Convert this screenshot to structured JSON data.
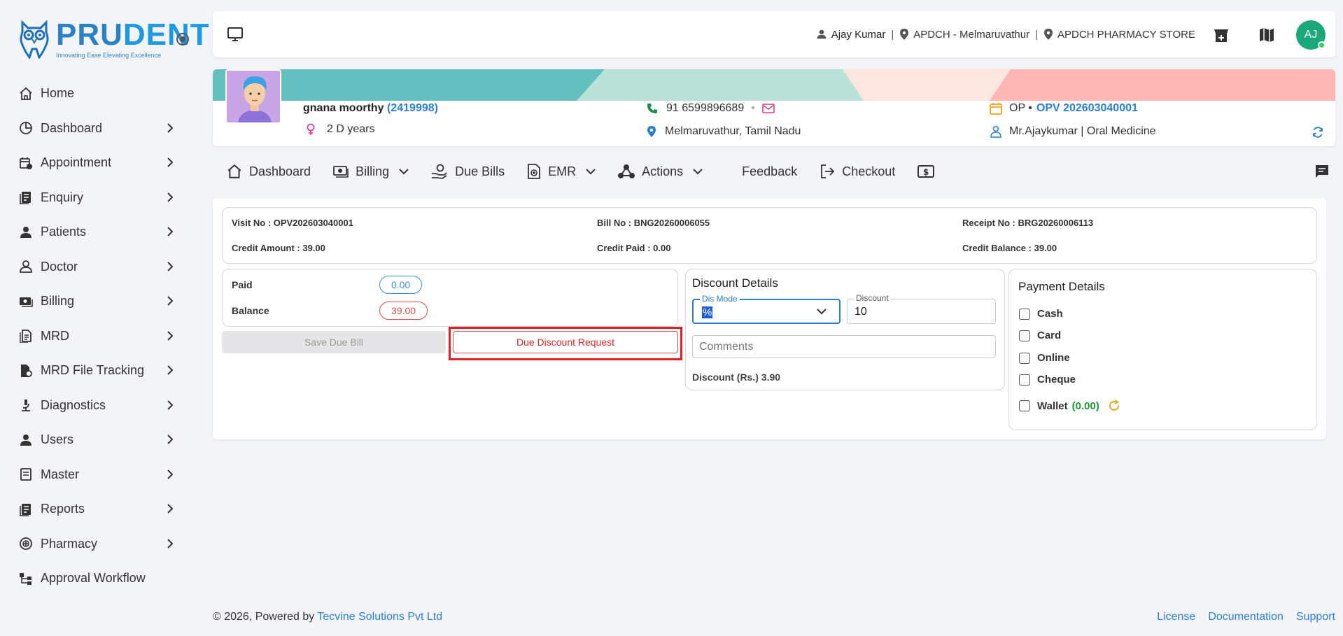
{
  "brand": {
    "name_part1": "PRU",
    "name_part2": "DENT",
    "tagline": "Innovating Ease Elevating Excellence"
  },
  "sidebar": {
    "items": [
      {
        "label": "Home",
        "icon": "home-icon"
      },
      {
        "label": "Dashboard",
        "icon": "pie-chart-icon"
      },
      {
        "label": "Appointment",
        "icon": "calendar-clock-icon"
      },
      {
        "label": "Enquiry",
        "icon": "document-list-icon"
      },
      {
        "label": "Patients",
        "icon": "person-icon"
      },
      {
        "label": "Doctor",
        "icon": "doctor-icon"
      },
      {
        "label": "Billing",
        "icon": "cash-icon"
      },
      {
        "label": "MRD",
        "icon": "records-icon"
      },
      {
        "label": "MRD File Tracking",
        "icon": "file-tracking-icon"
      },
      {
        "label": "Diagnostics",
        "icon": "microscope-icon"
      },
      {
        "label": "Users",
        "icon": "person-icon"
      },
      {
        "label": "Master",
        "icon": "master-list-icon"
      },
      {
        "label": "Reports",
        "icon": "report-icon"
      },
      {
        "label": "Pharmacy",
        "icon": "pharmacy-icon"
      },
      {
        "label": "Approval Workflow",
        "icon": "workflow-icon"
      }
    ]
  },
  "topbar": {
    "user_name": "Ajay Kumar",
    "location": "APDCH - Melmaruvathur",
    "store": "APDCH PHARMACY STORE",
    "avatar_initials": "AJ",
    "separator": "|"
  },
  "patient": {
    "name": "gnana moorthy",
    "id": "(2419998)",
    "age": "2 D years",
    "phone": "91 6599896689",
    "bullet": "•",
    "address": "Melmaruvathur, Tamil Nadu",
    "visit_type": "OP •",
    "visit_no": "OPV 202603040001",
    "doctor": "Mr.Ajaykumar | Oral Medicine"
  },
  "tabs": [
    {
      "label": "Dashboard"
    },
    {
      "label": "Billing"
    },
    {
      "label": "Due Bills"
    },
    {
      "label": "EMR"
    },
    {
      "label": "Actions"
    },
    {
      "label": "Feedback"
    },
    {
      "label": "Checkout"
    }
  ],
  "bill_info": {
    "visit_no": "Visit No : OPV202603040001",
    "bill_no": "Bill No : BNG20260006055",
    "receipt_no": "Receipt No : BRG20260006113",
    "credit_amount": "Credit Amount : 39.00",
    "credit_paid": "Credit Paid : 0.00",
    "credit_balance": "Credit Balance : 39.00"
  },
  "payment_summary": {
    "paid_label": "Paid",
    "paid_value": "0.00",
    "balance_label": "Balance",
    "balance_value": "39.00"
  },
  "actions": {
    "save_due_bill": "Save Due Bill",
    "due_discount_request": "Due Discount Request"
  },
  "discount": {
    "title": "Discount Details",
    "mode_label": "Dis Mode",
    "mode_value": "%",
    "discount_label": "Discount",
    "discount_value": "10",
    "comments_placeholder": "Comments",
    "amount_text": "Discount (Rs.) 3.90"
  },
  "payment_details": {
    "title": "Payment Details",
    "options": [
      "Cash",
      "Card",
      "Online",
      "Cheque"
    ],
    "wallet_label": "Wallet",
    "wallet_amount": "(0.00)"
  },
  "footer": {
    "copyright": "© 2026, Powered by ",
    "company": "Tecvine Solutions Pvt Ltd",
    "links": [
      "License",
      "Documentation",
      "Support"
    ]
  },
  "colors": {
    "accent": "#2a7fd4",
    "danger": "#e24a4a",
    "success": "#1c9a37",
    "band_teal": "#63c0bf",
    "band_mint": "#b9e2d9",
    "band_peach": "#fde6df",
    "band_pink": "#fcb7b5"
  }
}
